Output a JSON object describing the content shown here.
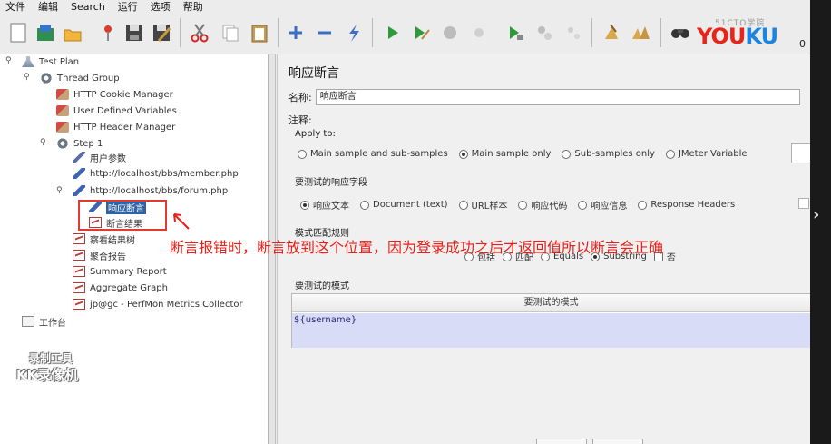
{
  "menu": {
    "items": [
      "文件",
      "编辑",
      "Search",
      "运行",
      "选项",
      "帮助"
    ]
  },
  "toolbar": {
    "logo_text": "YOUKU",
    "logo_sub": "51CTO学院",
    "count": "0",
    "icons": [
      "new-icon",
      "templates-icon",
      "open-icon",
      "close-icon",
      "save-icon",
      "save-as-icon",
      "cut-icon",
      "copy-icon",
      "paste-icon",
      "expand-icon",
      "collapse-icon",
      "toggle-icon",
      "start-icon",
      "start-no-pause-icon",
      "stop-icon",
      "shutdown-icon",
      "remote-start-icon",
      "remote-stop-icon",
      "remote-shutdown-icon",
      "clear-icon",
      "clear-all-icon",
      "search-icon"
    ]
  },
  "tree": {
    "nodes": [
      {
        "label": "Test Plan",
        "icon": "test-plan-icon"
      },
      {
        "label": "Thread Group",
        "icon": "thread-group-icon"
      },
      {
        "label": "HTTP Cookie Manager",
        "icon": "config-element-icon"
      },
      {
        "label": "User Defined Variables",
        "icon": "config-element-icon"
      },
      {
        "label": "HTTP Header Manager",
        "icon": "config-element-icon"
      },
      {
        "label": "Step 1",
        "icon": "controller-icon"
      },
      {
        "label": "用户参数",
        "icon": "pre-processor-icon"
      },
      {
        "label": "http://localhost/bbs/member.php",
        "icon": "sampler-icon"
      },
      {
        "label": "http://localhost/bbs/forum.php",
        "icon": "sampler-icon"
      },
      {
        "label": "响应断言",
        "icon": "assertion-icon"
      },
      {
        "label": "断言结果",
        "icon": "listener-icon"
      },
      {
        "label": "察看结果树",
        "icon": "listener-icon"
      },
      {
        "label": "聚合报告",
        "icon": "listener-icon"
      },
      {
        "label": "Summary Report",
        "icon": "listener-icon"
      },
      {
        "label": "Aggregate Graph",
        "icon": "listener-icon"
      },
      {
        "label": "jp@gc - PerfMon Metrics Collector",
        "icon": "listener-icon"
      },
      {
        "label": "工作台",
        "icon": "workbench-icon"
      }
    ]
  },
  "watermark": {
    "line1": "录制工具",
    "line2": "KK录像机"
  },
  "panel": {
    "title": "响应断言",
    "name_label": "名称:",
    "name_value": "响应断言",
    "comment_label": "注释:",
    "apply_to_label": "Apply to:",
    "apply_to_options": [
      {
        "label": "Main sample and sub-samples",
        "selected": false
      },
      {
        "label": "Main sample only",
        "selected": true
      },
      {
        "label": "Sub-samples only",
        "selected": false
      },
      {
        "label": "JMeter Variable",
        "selected": false
      }
    ],
    "field_label": "要测试的响应字段",
    "field_options": [
      {
        "label": "响应文本",
        "selected": true
      },
      {
        "label": "Document (text)",
        "selected": false
      },
      {
        "label": "URL样本",
        "selected": false
      },
      {
        "label": "响应代码",
        "selected": false
      },
      {
        "label": "响应信息",
        "selected": false
      },
      {
        "label": "Response Headers",
        "selected": false
      }
    ],
    "rule_label": "模式匹配规则",
    "rule_options": [
      {
        "label": "包括",
        "selected": false
      },
      {
        "label": "匹配",
        "selected": false
      },
      {
        "label": "Equals",
        "selected": false
      },
      {
        "label": "Substring",
        "selected": true
      }
    ],
    "not_label": "否",
    "patterns_label": "要测试的模式",
    "patterns_header": "要测试的模式",
    "pattern_value": "${username}"
  },
  "annotation": {
    "text": "断言报错时，断言放到这个位置，因为登录成功之后才返回值所以断言会正确",
    "color": "#e8201a"
  }
}
